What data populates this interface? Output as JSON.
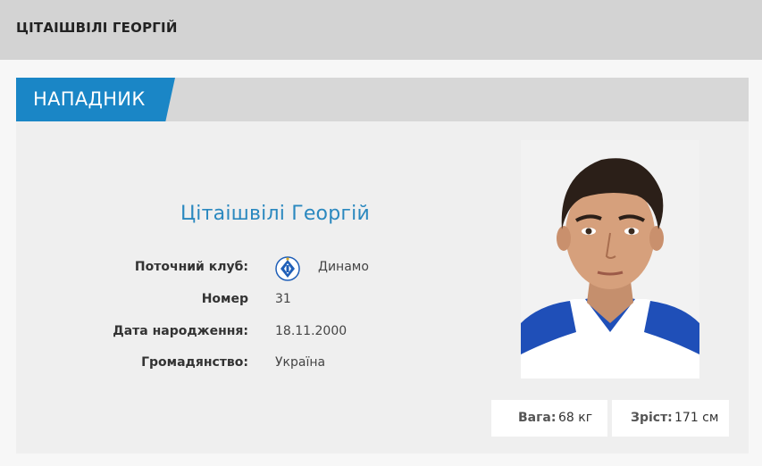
{
  "header": {
    "title": "ЦІТАІШВІЛІ ГЕОРГІЙ"
  },
  "position": {
    "label": "НАПАДНИК"
  },
  "player": {
    "name": "Цітаішвілі Георгій",
    "info": [
      {
        "label": "Поточний клуб:",
        "value": "Динамо"
      },
      {
        "label": "Номер",
        "value": "31"
      },
      {
        "label": "Дата народження:",
        "value": "18.11.2000"
      },
      {
        "label": "Громадянство:",
        "value": "Україна"
      }
    ],
    "stats": [
      {
        "label": "Вага:",
        "value": "68 кг"
      },
      {
        "label": "Зріст:",
        "value": "171 см"
      }
    ]
  },
  "icons": {
    "club_logo": "dynamo-logo-icon",
    "photo": "player-photo"
  },
  "colors": {
    "accent": "#1a86c6",
    "name": "#2a88bf",
    "kit_blue": "#1f4fb8"
  }
}
